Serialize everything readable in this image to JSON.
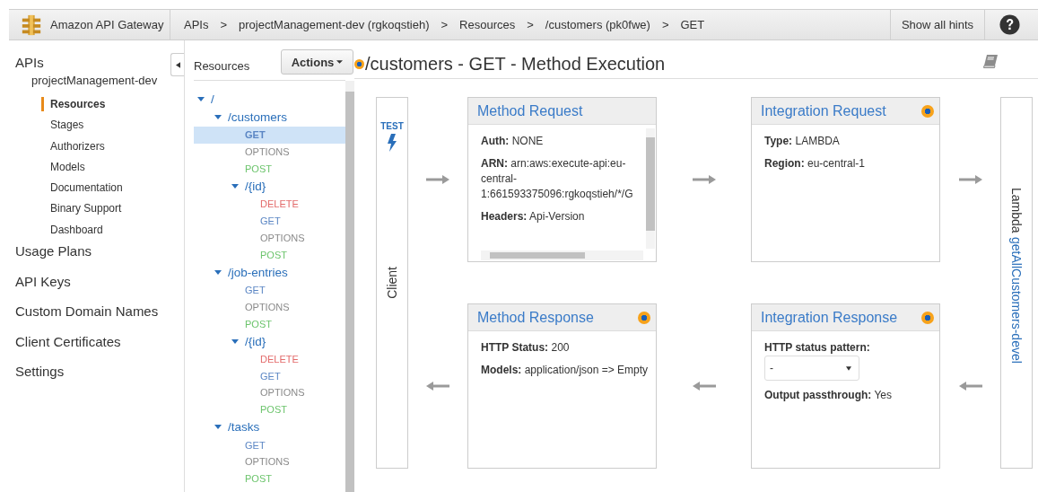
{
  "header": {
    "product": "Amazon API Gateway",
    "breadcrumbs": [
      {
        "label": "APIs"
      },
      {
        "separator": ">",
        "label": "projectManagement-dev (rgkoqstieh)"
      },
      {
        "separator": ">",
        "label": "Resources"
      },
      {
        "separator": ">",
        "label": "/customers (pk0fwe)"
      },
      {
        "separator": ">",
        "label": "GET"
      }
    ],
    "hints_button": "Show all hints"
  },
  "sidebar": {
    "items": [
      {
        "label": "APIs",
        "children": [
          {
            "label": "projectManagement-dev",
            "children": [
              {
                "label": "Resources",
                "selected": true
              },
              {
                "label": "Stages",
                "selected": false
              },
              {
                "label": "Authorizers",
                "selected": false
              },
              {
                "label": "Models",
                "selected": false
              },
              {
                "label": "Documentation",
                "selected": false
              },
              {
                "label": "Binary Support",
                "selected": false
              },
              {
                "label": "Dashboard",
                "selected": false
              }
            ]
          }
        ]
      },
      {
        "label": "Usage Plans"
      },
      {
        "label": "API Keys"
      },
      {
        "label": "Custom Domain Names"
      },
      {
        "label": "Client Certificates"
      },
      {
        "label": "Settings"
      }
    ]
  },
  "resources": {
    "title": "Resources",
    "actions_button": "Actions",
    "tree": [
      {
        "kind": "resource",
        "label": "/",
        "expanded": true,
        "selected": false,
        "children": [
          {
            "kind": "resource",
            "label": "/customers",
            "expanded": true,
            "selected": false,
            "children": [
              {
                "kind": "method",
                "label": "GET",
                "color": "#5b86c4",
                "selected": true
              },
              {
                "kind": "method",
                "label": "OPTIONS",
                "color": "#8a8a8a",
                "selected": false
              },
              {
                "kind": "method",
                "label": "POST",
                "color": "#6cc46c",
                "selected": false
              },
              {
                "kind": "resource",
                "label": "/{id}",
                "expanded": true,
                "selected": false,
                "children": [
                  {
                    "kind": "method",
                    "label": "DELETE",
                    "color": "#e36a6a",
                    "selected": false
                  },
                  {
                    "kind": "method",
                    "label": "GET",
                    "color": "#5b86c4",
                    "selected": false
                  },
                  {
                    "kind": "method",
                    "label": "OPTIONS",
                    "color": "#8a8a8a",
                    "selected": false
                  },
                  {
                    "kind": "method",
                    "label": "POST",
                    "color": "#6cc46c",
                    "selected": false
                  }
                ]
              }
            ]
          },
          {
            "kind": "resource",
            "label": "/job-entries",
            "expanded": true,
            "selected": false,
            "children": [
              {
                "kind": "method",
                "label": "GET",
                "color": "#5b86c4",
                "selected": false
              },
              {
                "kind": "method",
                "label": "OPTIONS",
                "color": "#8a8a8a",
                "selected": false
              },
              {
                "kind": "method",
                "label": "POST",
                "color": "#6cc46c",
                "selected": false
              },
              {
                "kind": "resource",
                "label": "/{id}",
                "expanded": true,
                "selected": false,
                "children": [
                  {
                    "kind": "method",
                    "label": "DELETE",
                    "color": "#e36a6a",
                    "selected": false
                  },
                  {
                    "kind": "method",
                    "label": "GET",
                    "color": "#5b86c4",
                    "selected": false
                  },
                  {
                    "kind": "method",
                    "label": "OPTIONS",
                    "color": "#8a8a8a",
                    "selected": false
                  },
                  {
                    "kind": "method",
                    "label": "POST",
                    "color": "#6cc46c",
                    "selected": false
                  }
                ]
              }
            ]
          },
          {
            "kind": "resource",
            "label": "/tasks",
            "expanded": true,
            "selected": false,
            "children": [
              {
                "kind": "method",
                "label": "GET",
                "color": "#5b86c4",
                "selected": false
              },
              {
                "kind": "method",
                "label": "OPTIONS",
                "color": "#8a8a8a",
                "selected": false
              },
              {
                "kind": "method",
                "label": "POST",
                "color": "#6cc46c",
                "selected": false
              }
            ]
          }
        ]
      }
    ]
  },
  "execution": {
    "title": "/customers - GET - Method Execution",
    "indicator": true,
    "client": {
      "test_label": "TEST",
      "label": "Client"
    },
    "lambda": {
      "prefix": "Lambda",
      "link": "getAllCustomers-devel"
    },
    "cards": [
      {
        "title": "Method Request",
        "indicator": false,
        "scrollbars": true,
        "fields": [
          {
            "kind": "text",
            "label": "Auth:",
            "value": "NONE"
          },
          {
            "kind": "text",
            "label": "ARN:",
            "value": "arn:aws:execute-api:eu-central-1:661593375096:rgkoqstieh/*/G"
          },
          {
            "kind": "text",
            "label": "Headers:",
            "value": "Api-Version"
          }
        ]
      },
      {
        "title": "Integration Request",
        "indicator": true,
        "scrollbars": false,
        "fields": [
          {
            "kind": "text",
            "label": "Type:",
            "value": "LAMBDA"
          },
          {
            "kind": "text",
            "label": "Region:",
            "value": "eu-central-1"
          }
        ]
      },
      {
        "title": "Method Response",
        "indicator": true,
        "scrollbars": false,
        "fields": [
          {
            "kind": "text",
            "label": "HTTP Status:",
            "value": "200"
          },
          {
            "kind": "text",
            "label": "Models:",
            "value": "application/json => Empty"
          }
        ]
      },
      {
        "title": "Integration Response",
        "indicator": true,
        "scrollbars": false,
        "fields": [
          {
            "kind": "select",
            "label": "HTTP status pattern:",
            "value": "-"
          },
          {
            "kind": "text",
            "label": "Output passthrough:",
            "value": "Yes"
          }
        ]
      }
    ]
  }
}
